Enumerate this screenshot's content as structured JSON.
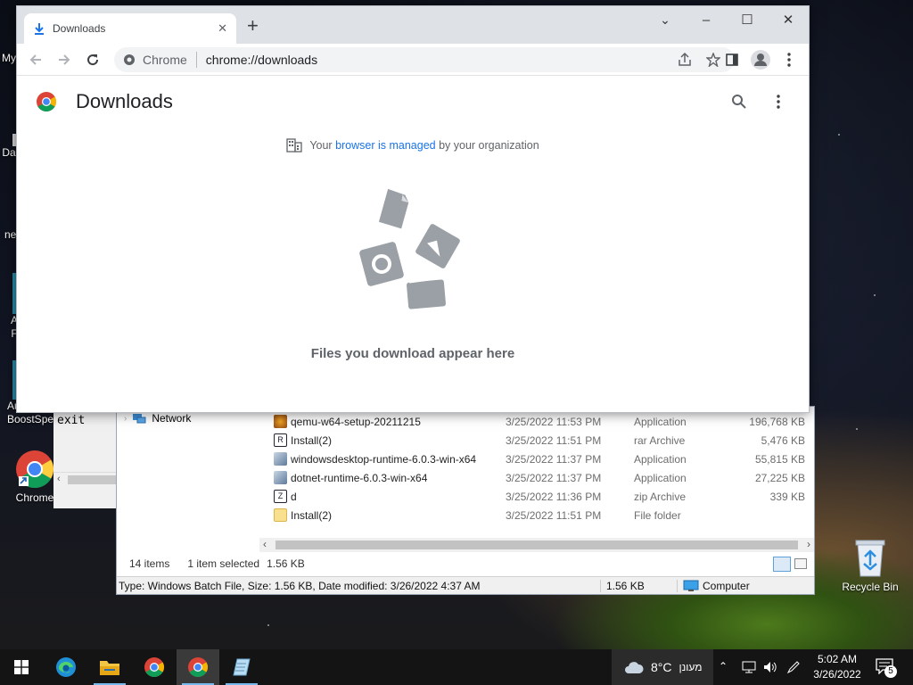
{
  "desktop": {
    "icons_left": [
      {
        "label": "My"
      },
      {
        "label": "Da"
      },
      {
        "label": "ne"
      },
      {
        "label": "A"
      },
      {
        "label": "F"
      },
      {
        "label": "Auslogic"
      },
      {
        "label": "BoostSpe"
      },
      {
        "label": "Chrome"
      }
    ],
    "recycle_bin": {
      "label": "Recycle Bin"
    }
  },
  "chrome": {
    "tab": {
      "title": "Downloads",
      "close": "✕"
    },
    "new_tab": "+",
    "window_controls": {
      "dropdown": "⌄",
      "minimize": "–",
      "maximize": "☐",
      "close": "✕"
    },
    "omnibox": {
      "site": "Chrome",
      "url": "chrome://downloads"
    },
    "page": {
      "title": "Downloads",
      "managed_prefix": "Your ",
      "managed_link": "browser is managed",
      "managed_suffix": " by your organization",
      "empty_message": "Files you download appear here"
    }
  },
  "cmd": {
    "text": "exit"
  },
  "explorer": {
    "nav": {
      "network": "Network"
    },
    "files": [
      {
        "name": "qemu-w64-setup-20211215",
        "date": "3/25/2022 11:53 PM",
        "type": "Application",
        "size": "196,768 KB",
        "icon": "qemu-icon"
      },
      {
        "name": "Install(2)",
        "date": "3/25/2022 11:51 PM",
        "type": "rar Archive",
        "size": "5,476 KB",
        "icon": "rar-icon"
      },
      {
        "name": "windowsdesktop-runtime-6.0.3-win-x64",
        "date": "3/25/2022 11:37 PM",
        "type": "Application",
        "size": "55,815 KB",
        "icon": "installer-icon"
      },
      {
        "name": "dotnet-runtime-6.0.3-win-x64",
        "date": "3/25/2022 11:37 PM",
        "type": "Application",
        "size": "27,225 KB",
        "icon": "installer-icon"
      },
      {
        "name": "d",
        "date": "3/25/2022 11:36 PM",
        "type": "zip Archive",
        "size": "339 KB",
        "icon": "zip-icon"
      },
      {
        "name": "Install(2)",
        "date": "3/25/2022 11:51 PM",
        "type": "File folder",
        "size": "",
        "icon": "folder-icon"
      }
    ],
    "status": {
      "items": "14 items",
      "selected": "1 item selected",
      "size": "1.56 KB"
    },
    "bottom": {
      "details": "Type: Windows Batch File, Size: 1.56 KB, Date modified: 3/26/2022 4:37 AM",
      "size": "1.56 KB",
      "location": "Computer"
    }
  },
  "taskbar": {
    "weather": {
      "temp": "8°C",
      "condition": "מעונן"
    },
    "clock": {
      "time": "5:02 AM",
      "date": "3/26/2022"
    },
    "notifications": "5"
  },
  "colors": {
    "accent": "#1a73e8",
    "taskbar": "#141414",
    "tabstrip": "#dee1e6"
  }
}
